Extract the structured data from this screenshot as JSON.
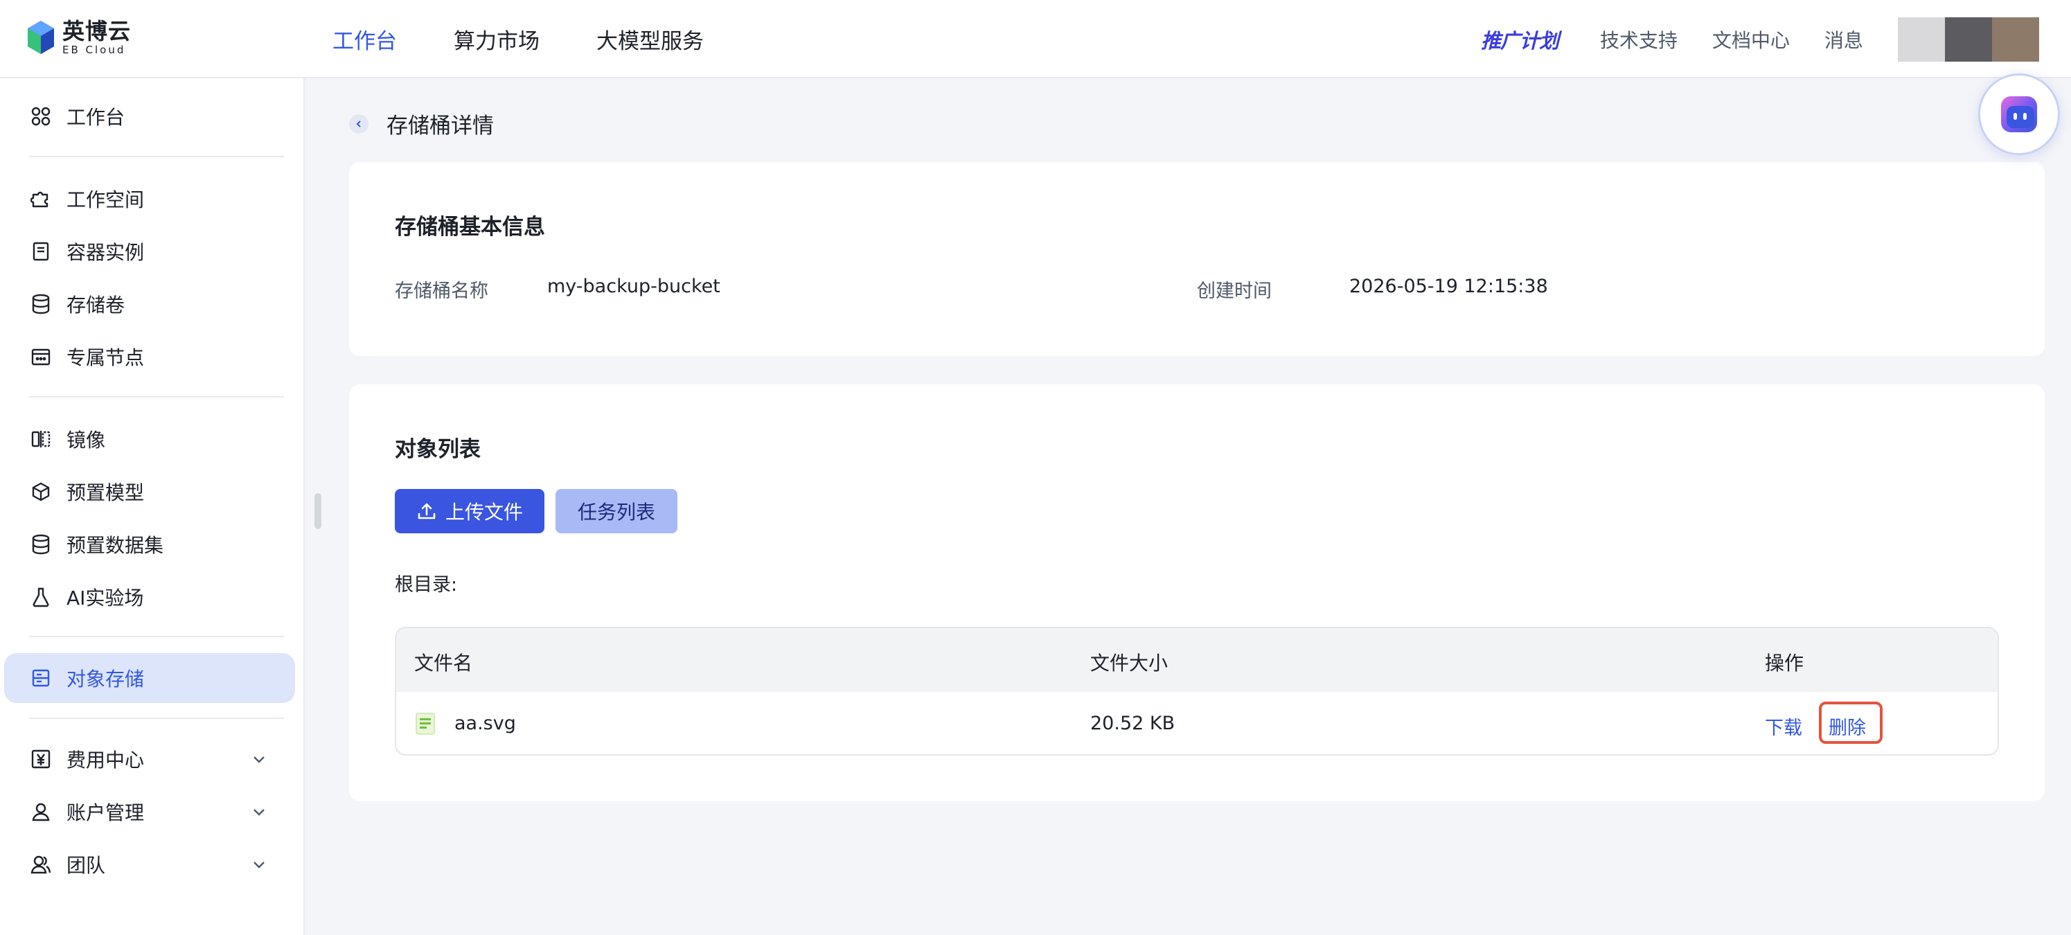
{
  "brand": {
    "name_cn": "英博云",
    "name_en": "EB Cloud",
    "colors": {
      "accent": "#3358e6",
      "primary_button": "#3a55e0",
      "secondary_button": "#a8baf6",
      "highlight_border": "#e5533f"
    }
  },
  "topnav": {
    "items": [
      {
        "label": "工作台",
        "active": true
      },
      {
        "label": "算力市场",
        "active": false
      },
      {
        "label": "大模型服务",
        "active": false
      }
    ],
    "right": {
      "promo": "推广计划",
      "links": [
        "技术支持",
        "文档中心",
        "消息"
      ]
    }
  },
  "sidebar": {
    "items": [
      {
        "label": "工作台",
        "icon": "grid-icon"
      },
      {
        "label": "工作空间",
        "icon": "puzzle-icon"
      },
      {
        "label": "容器实例",
        "icon": "container-icon"
      },
      {
        "label": "存储卷",
        "icon": "database-icon"
      },
      {
        "label": "专属节点",
        "icon": "calendar-node-icon"
      },
      {
        "label": "镜像",
        "icon": "mirror-icon"
      },
      {
        "label": "预置模型",
        "icon": "cube-icon"
      },
      {
        "label": "预置数据集",
        "icon": "dataset-icon"
      },
      {
        "label": "AI实验场",
        "icon": "flask-icon"
      },
      {
        "label": "对象存储",
        "icon": "storage-box-icon",
        "active": true
      },
      {
        "label": "费用中心",
        "icon": "yen-icon",
        "expandable": true
      },
      {
        "label": "账户管理",
        "icon": "user-icon",
        "expandable": true
      },
      {
        "label": "团队",
        "icon": "team-icon",
        "expandable": true
      }
    ]
  },
  "page": {
    "title": "存储桶详情"
  },
  "basic_info": {
    "title": "存储桶基本信息",
    "name_label": "存储桶名称",
    "name_value": "my-backup-bucket",
    "created_label": "创建时间",
    "created_value": "2026-05-19 12:15:38"
  },
  "objects": {
    "title": "对象列表",
    "upload_button": "上传文件",
    "tasks_button": "任务列表",
    "root_dir_label": "根目录:",
    "columns": [
      "文件名",
      "文件大小",
      "操作"
    ],
    "rows": [
      {
        "name": "aa.svg",
        "size": "20.52 KB",
        "actions": [
          "下载",
          "删除"
        ]
      }
    ]
  }
}
